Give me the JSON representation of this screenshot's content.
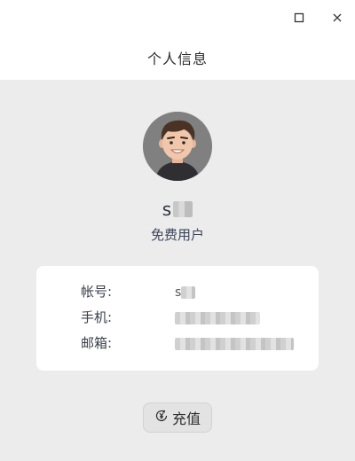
{
  "window": {
    "title": "个人信息"
  },
  "profile": {
    "name_visible": "s",
    "user_type": "免费用户"
  },
  "account_info": {
    "account_label": "帐号:",
    "account_value_visible": "s",
    "phone_label": "手机:",
    "email_label": "邮箱:"
  },
  "actions": {
    "recharge_label": "充值"
  }
}
